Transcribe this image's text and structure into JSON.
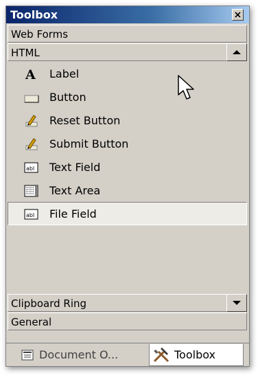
{
  "window": {
    "title": "Toolbox",
    "close_glyph": "×"
  },
  "categories": {
    "web_forms": "Web Forms",
    "html": "HTML",
    "clipboard_ring": "Clipboard Ring",
    "general": "General"
  },
  "items": [
    {
      "label": "Label",
      "icon": "label-a-icon"
    },
    {
      "label": "Button",
      "icon": "button-icon"
    },
    {
      "label": "Reset Button",
      "icon": "reset-button-icon"
    },
    {
      "label": "Submit Button",
      "icon": "submit-button-icon"
    },
    {
      "label": "Text Field",
      "icon": "text-field-icon"
    },
    {
      "label": "Text Area",
      "icon": "text-area-icon"
    },
    {
      "label": "File Field",
      "icon": "file-field-icon",
      "selected": true
    }
  ],
  "tabs": [
    {
      "label": "Document O...",
      "icon": "document-outline-icon",
      "active": false
    },
    {
      "label": "Toolbox",
      "icon": "hammer-icon",
      "active": true
    }
  ],
  "colors": {
    "title_start": "#0a246a",
    "title_end": "#a6caf0",
    "face": "#d4d0c8"
  }
}
